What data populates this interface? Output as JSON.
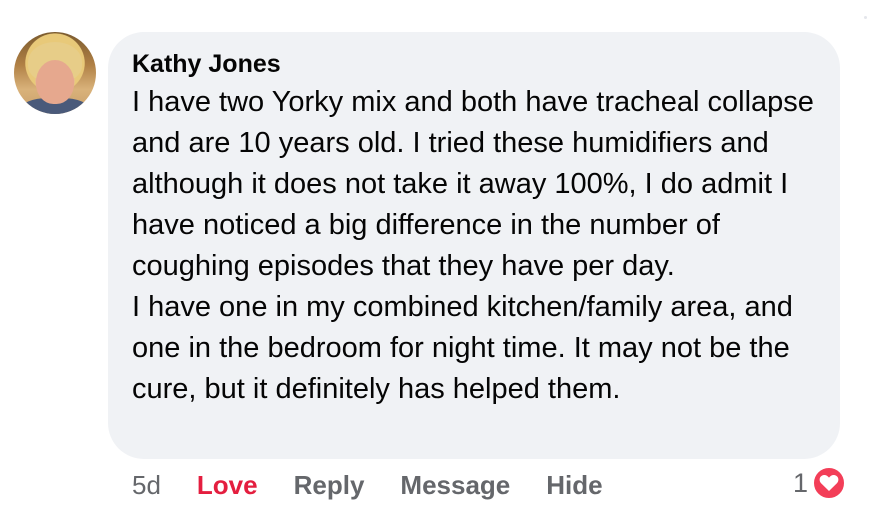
{
  "comment": {
    "author": "Kathy Jones",
    "paragraphs": [
      "I have two Yorky mix and both have tracheal collapse and are 10 years old. I tried these humidifiers and although it does not take it away 100%, I do admit I have noticed a big difference in the number of coughing episodes that they have per day.",
      "I have one in my combined kitchen/family area, and one in the bedroom for night time. It may not be the cure, but it definitely has helped them."
    ]
  },
  "actions": {
    "timestamp": "5d",
    "love_label": "Love",
    "reply_label": "Reply",
    "message_label": "Message",
    "hide_label": "Hide"
  },
  "reactions": {
    "count": "1",
    "icon": "heart-icon",
    "badge_color": "#f33e58"
  },
  "colors": {
    "bubble_bg": "#f0f2f5",
    "love_active": "#e41e3f",
    "secondary_text": "#65676b",
    "primary_text": "#050505"
  }
}
